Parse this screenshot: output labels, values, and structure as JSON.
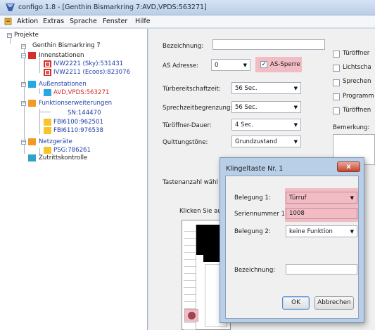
{
  "window": {
    "title": "configo 1.8 - [Genthin Bismarkring 7:AVD,VPDS:563271]"
  },
  "menu": {
    "items": [
      "Aktion",
      "Extras",
      "Sprache",
      "Fenster",
      "Hilfe"
    ]
  },
  "tree": {
    "root": "Projekte",
    "project": "Genthin Bismarkring 7",
    "innenstationen": "Innenstationen",
    "innen_items": [
      "IVW2221 (Sky):531431",
      "IVW2211 (Ecoos):823076"
    ],
    "aussenstationen": "Außenstationen",
    "aussen_item": "AVD,VPDS:563271",
    "funktionserweiterungen": "Funktionserweiterungen",
    "funktion_items": [
      "SN:144470",
      "FBI6100:962501",
      "FBI6110:976538"
    ],
    "netzgeraete": "Netzgeräte",
    "netz_item": "PSG:786261",
    "zutrittskontrolle": "Zutrittskontrolle"
  },
  "form": {
    "bezeichnung_label": "Bezeichnung:",
    "bezeichnung_value": "",
    "as_adresse_label": "AS Adresse:",
    "as_adresse_value": "0",
    "as_sperre_label": "AS-Sperre",
    "as_sperre_checked": true,
    "tuerbereitschaftzeit_label": "Türbereitschaftzeit:",
    "tuerbereitschaftzeit_value": "56 Sec.",
    "sprechzeit_label": "Sprechzeitbegrenzung:",
    "sprechzeit_value": "56 Sec.",
    "tueroeffner_dauer_label": "Türöffner-Dauer:",
    "tueroeffner_dauer_value": "4 Sec.",
    "quittungstoene_label": "Quittungstöne:",
    "quittungstoene_value": "Grundzustand",
    "tastenanzahl_label": "Tastenanzahl wähl",
    "klicken_label": "Klicken Sie au",
    "checkboxes": [
      "Türöffner",
      "Lichtscha",
      "Sprechen",
      "Programm",
      "Türöffnen"
    ],
    "bemerkung_label": "Bemerkung:"
  },
  "dialog": {
    "title": "Klingeltaste Nr. 1",
    "belegung1_label": "Belegung 1:",
    "belegung1_value": "Türruf",
    "seriennummer_label": "Seriennummer 1:",
    "seriennummer_value": "1008",
    "belegung2_label": "Belegung 2:",
    "belegung2_value": "keine Funktion",
    "bezeichnung_label": "Bezeichnung:",
    "bezeichnung_value": "",
    "ok_label": "OK",
    "cancel_label": "Abbrechen",
    "close_label": "x"
  },
  "colors": {
    "highlight": "#f2bcc5",
    "red": "#d3302c",
    "cyan": "#28a7e0",
    "orange": "#f19a28",
    "yellow": "#f7c52b"
  }
}
